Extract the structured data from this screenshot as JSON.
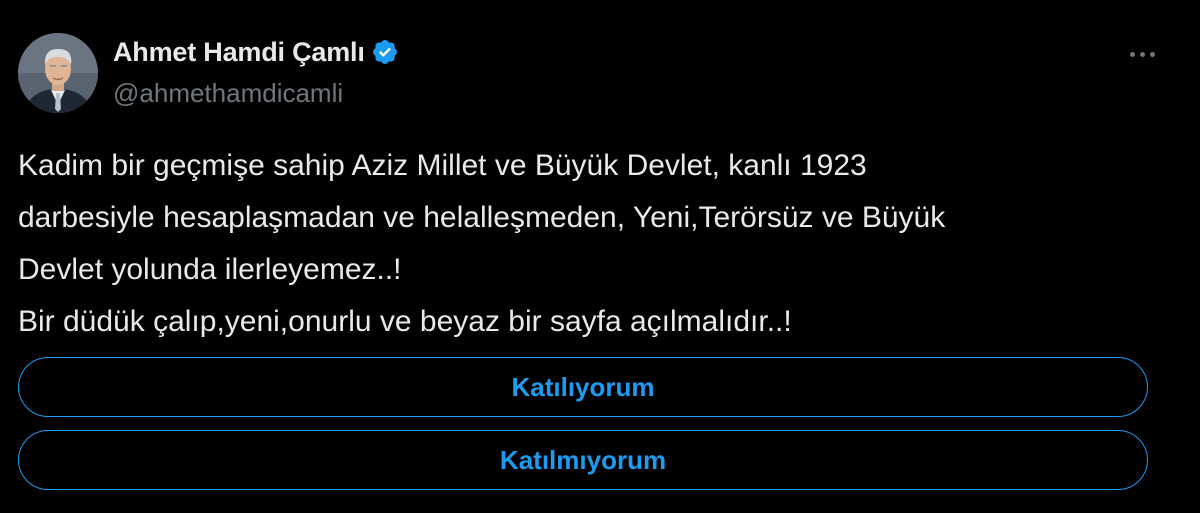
{
  "author": {
    "display_name": "Ahmet Hamdi Çamlı",
    "handle": "@ahmethamdicamli",
    "verified": true,
    "verified_icon": "verified-badge-icon"
  },
  "tweet": {
    "lines": [
      "Kadim bir geçmişe sahip Aziz Millet  ve Büyük Devlet, kanlı 1923",
      "darbesiyle hesaplaşmadan ve helalleşmeden, Yeni,Terörsüz ve Büyük",
      "Devlet yolunda ilerleyemez..!",
      "Bir düdük çalıp,yeni,onurlu ve beyaz bir sayfa açılmalıdır..!"
    ]
  },
  "poll": {
    "options": [
      {
        "label": "Katılıyorum"
      },
      {
        "label": "Katılmıyorum"
      }
    ]
  },
  "icons": {
    "more": "more-horizontal-icon"
  },
  "colors": {
    "background": "#000000",
    "text_primary": "#e7e9ea",
    "text_secondary": "#71767b",
    "accent": "#1d9bf0"
  }
}
